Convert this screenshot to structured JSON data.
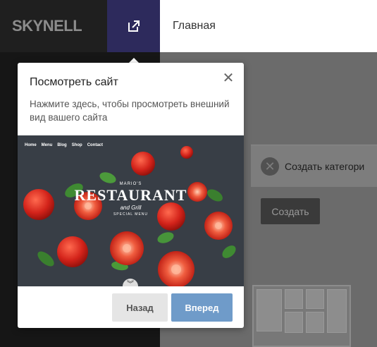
{
  "header": {
    "logo": "SKYNELL",
    "nav_title": "Главная"
  },
  "background": {
    "card_label": "Создать категори",
    "create_button": "Создать"
  },
  "tour": {
    "title": "Посмотреть сайт",
    "body": "Нажмите здесь, чтобы просмотреть внешний вид вашего сайта",
    "back_button": "Назад",
    "next_button": "Вперед",
    "preview": {
      "nav_items": [
        "Home",
        "Menu",
        "Blog",
        "Shop",
        "Contact"
      ],
      "brand_small": "MARIO'S",
      "brand_big": "RESTAURANT",
      "brand_sub": "and Grill",
      "brand_tag": "SPECIAL MENU"
    }
  },
  "colors": {
    "accent": "#2d2a5c",
    "next_button": "#6f9bc9"
  }
}
